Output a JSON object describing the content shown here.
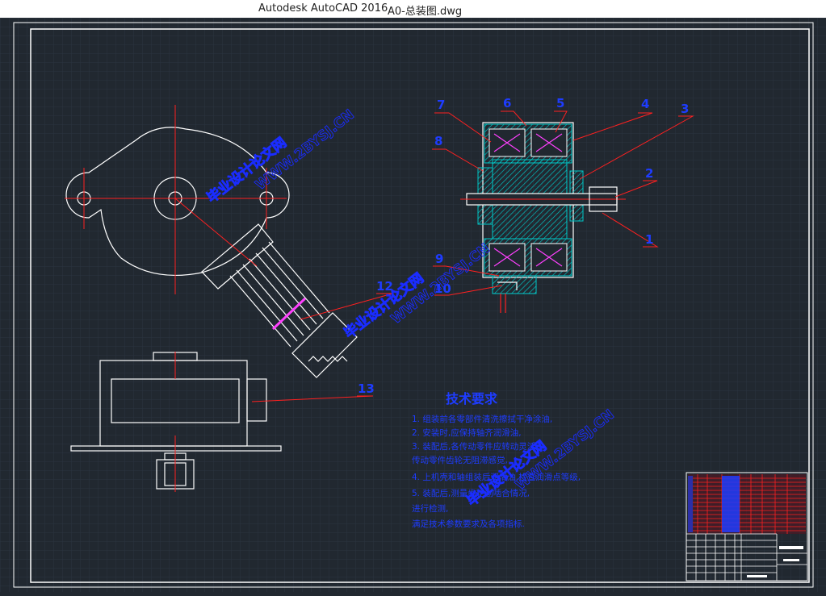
{
  "window": {
    "app_name": "Autodesk AutoCAD 2016",
    "file_name": "A0-总装图.dwg"
  },
  "colors": {
    "background": "#212830",
    "grid": "#2b3440",
    "line": "#ffffff",
    "leader": "#ff2020",
    "label": "#1e3cff",
    "hatch": "#00c8c8",
    "coil": "#ff40ff",
    "watermark": "#1a2cff"
  },
  "part_numbers": [
    "1",
    "2",
    "3",
    "4",
    "5",
    "6",
    "7",
    "8",
    "9",
    "10",
    "12",
    "13"
  ],
  "tech": {
    "title": "技术要求",
    "lines": [
      "1. 组装前各零部件清洗擦拭干净涂油,",
      "2. 安装时,应保持轴齐润滑油,",
      "3. 装配后,各传动零件应转动灵活,",
      "   传动零件齿轮无阻滞感觉,",
      "4. 上机壳和轴组装后润滑油,检查润滑点等级,",
      "5. 装配后,测量齿轮副啮合情况,",
      "   进行检测,",
      "   满足技术参数要求及各项指标."
    ]
  },
  "watermarks": [
    "毕业设计论文网",
    "WWW.2BYSJ.CN"
  ]
}
